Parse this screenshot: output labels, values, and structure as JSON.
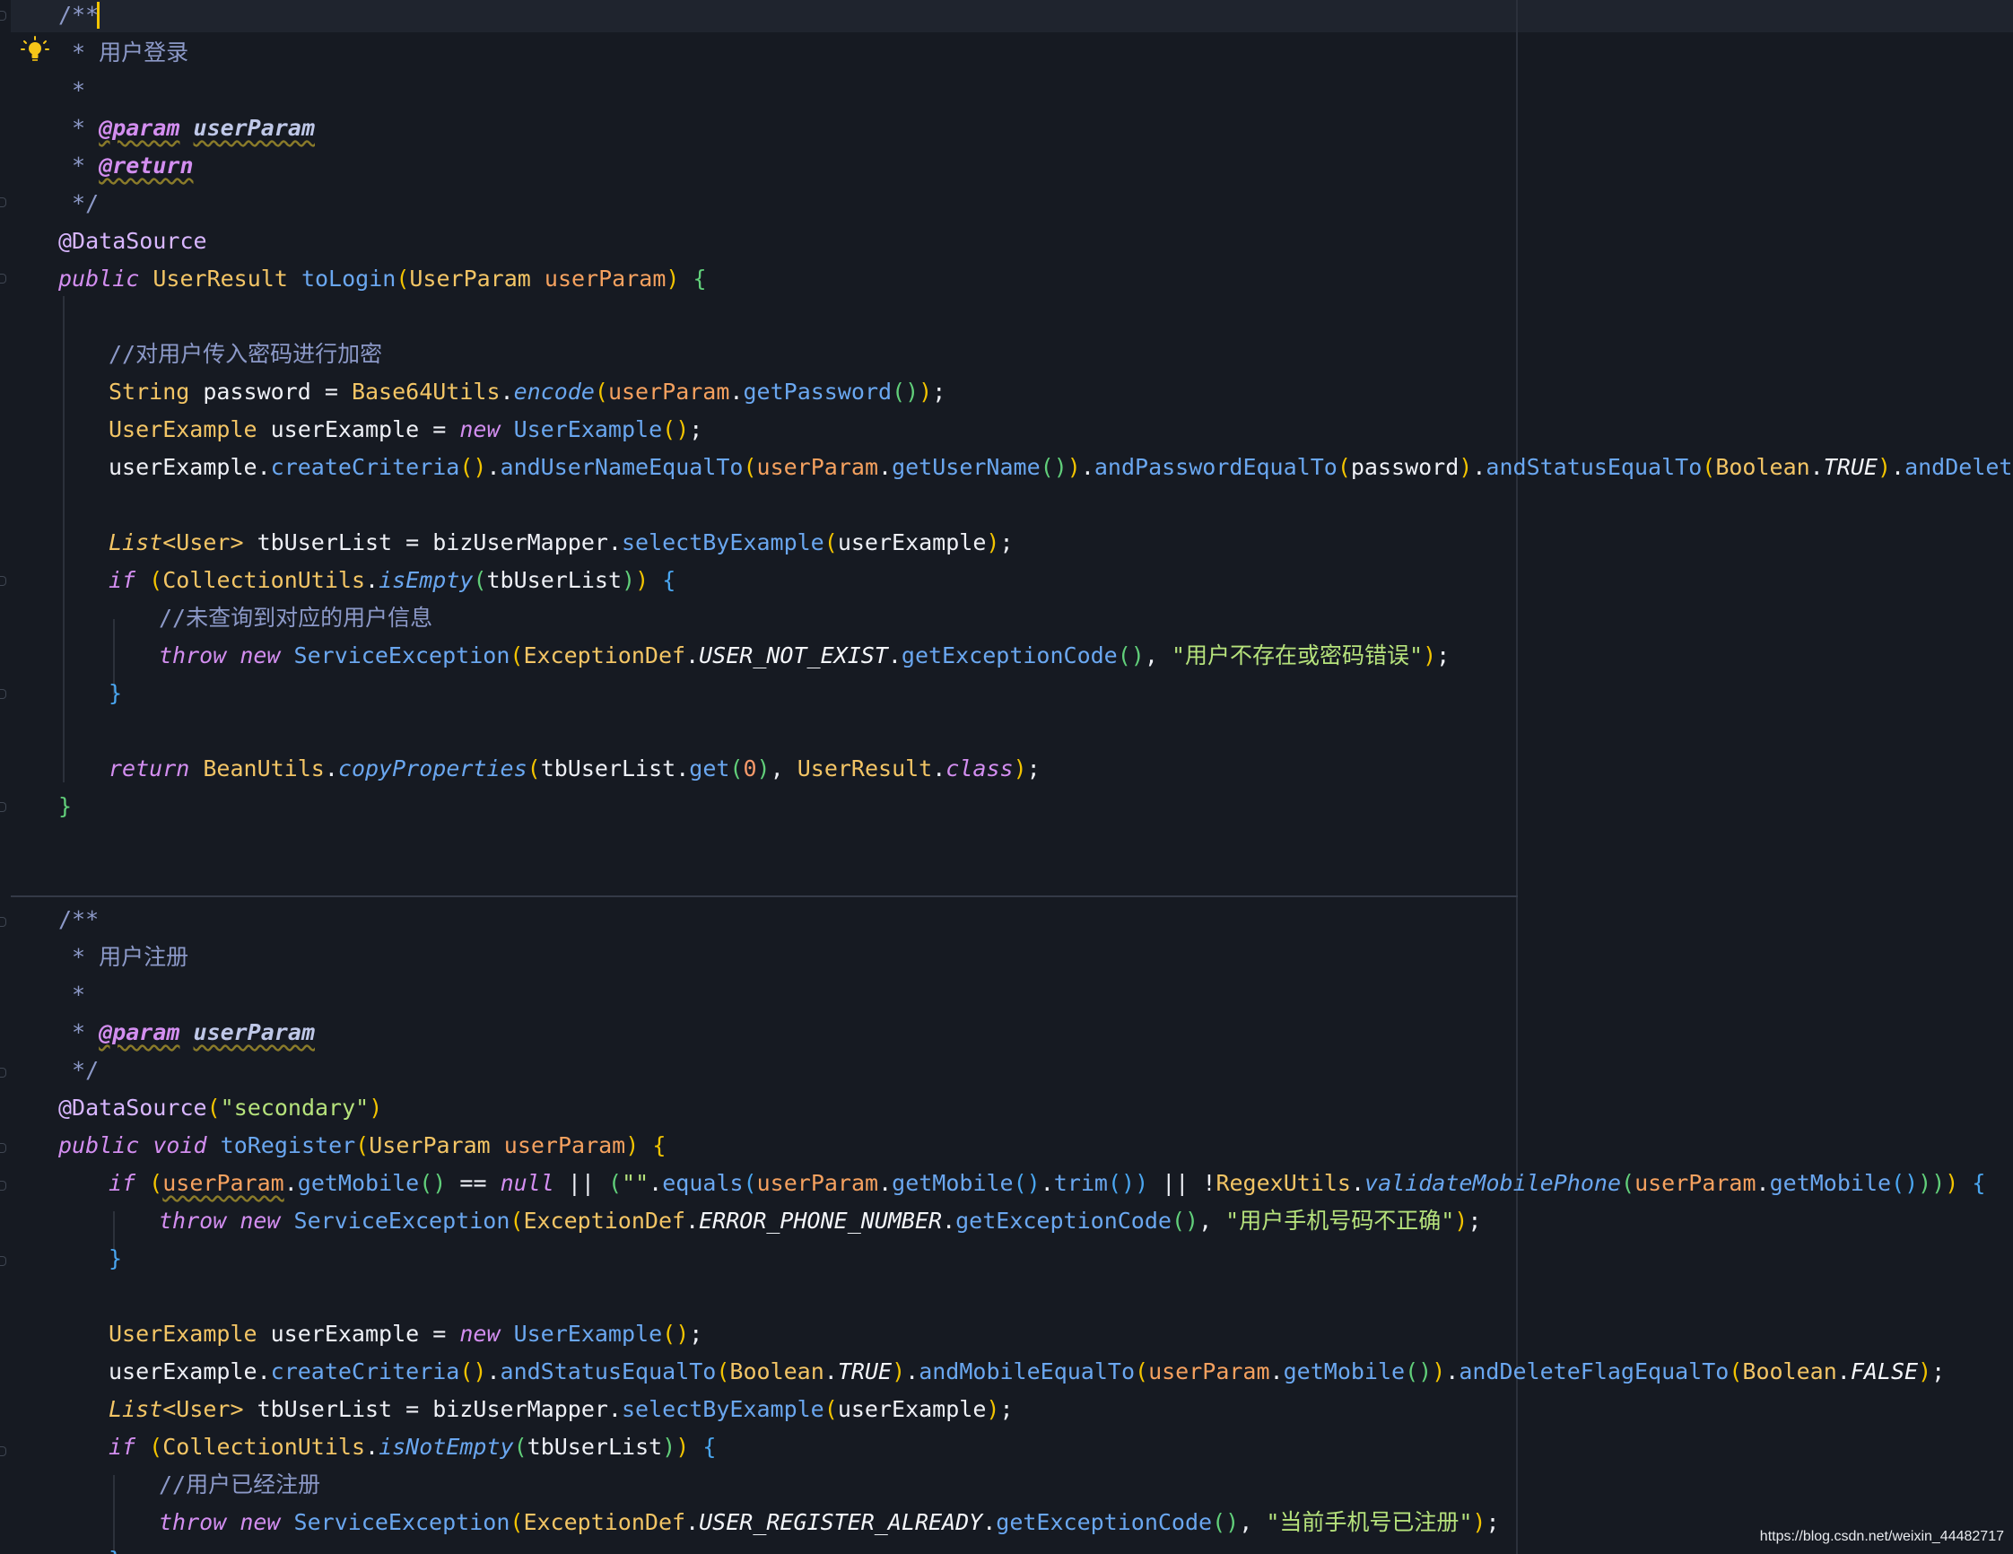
{
  "editor": {
    "language": "java",
    "theme_colors": {
      "background": "#161a22",
      "keyword": "#d38ef0",
      "class": "#f3c565",
      "method": "#6aa7f0",
      "comment": "#8c99c8",
      "string": "#b6e27c",
      "parameter": "#f5a15f",
      "caret": "#f3c400"
    },
    "gutter_icons": [
      "lightbulb-icon"
    ],
    "code": {
      "l1": "/**",
      "l2_star": " * ",
      "l2_text": "用户登录",
      "l3": " *",
      "l4_star": " * ",
      "l4_tag": "@param",
      "l4_sp": " ",
      "l4_name": "userParam",
      "l5_star": " * ",
      "l5_tag": "@return",
      "l6": " */",
      "l7": "@DataSource",
      "l8_kw": "public",
      "l8_sp1": " ",
      "l8_type": "UserResult",
      "l8_sp2": " ",
      "l8_fn": "toLogin",
      "l8_lp": "(",
      "l8_ptype": "UserParam",
      "l8_sp3": " ",
      "l8_pname": "userParam",
      "l8_rp": ")",
      "l8_sp4": " ",
      "l8_brace": "{",
      "l10": "//对用户传入密码进行加密",
      "l11_type": "String",
      "l11_var": " password = ",
      "l11_cls": "Base64Utils",
      "l11_dot": ".",
      "l11_fn": "encode",
      "l11_lp": "(",
      "l11_param": "userParam",
      "l11_dot2": ".",
      "l11_fn2": "getPassword",
      "l11_parens": "()",
      "l11_rp": ")",
      "l11_semi": ";",
      "l12_type": "UserExample",
      "l12_var": " userExample = ",
      "l12_kw": "new",
      "l12_sp": " ",
      "l12_fn": "UserExample",
      "l12_parens": "()",
      "l12_semi": ";",
      "l13_var": "userExample",
      "l13_d1": ".",
      "l13_f1": "createCriteria",
      "l13_p1": "()",
      "l13_d2": ".",
      "l13_f2": "andUserNameEqualTo",
      "l13_lp2": "(",
      "l13_param": "userParam",
      "l13_d3": ".",
      "l13_f3": "getUserName",
      "l13_p3": "()",
      "l13_rp2": ")",
      "l13_d4": ".",
      "l13_f4": "andPasswordEqualTo",
      "l13_lp4": "(",
      "l13_arg4": "password",
      "l13_rp4": ")",
      "l13_d5": ".",
      "l13_f5": "andStatusEqualTo",
      "l13_lp5": "(",
      "l13_cls5": "Boolean",
      "l13_d6": ".",
      "l13_const5": "TRUE",
      "l13_rp5": ")",
      "l13_d7": ".",
      "l13_f7": "andDeleteFlagEqualT",
      "l15_type": "List",
      "l15_gen": "<User>",
      "l15_var": " tbUserList = bizUserMapper.",
      "l15_fn": "selectByExample",
      "l15_lp": "(",
      "l15_arg": "userExample",
      "l15_rp": ")",
      "l15_semi": ";",
      "l16_kw": "if",
      "l16_sp": " ",
      "l16_lp": "(",
      "l16_cls": "CollectionUtils",
      "l16_dot": ".",
      "l16_fn": "isEmpty",
      "l16_lp2": "(",
      "l16_arg": "tbUserList",
      "l16_rp2": ")",
      "l16_rp": ")",
      "l16_sp2": " ",
      "l16_brace": "{",
      "l17": "//未查询到对应的用户信息",
      "l18_kw1": "throw",
      "l18_sp1": " ",
      "l18_kw2": "new",
      "l18_sp2": " ",
      "l18_fn": "ServiceException",
      "l18_lp": "(",
      "l18_cls": "ExceptionDef",
      "l18_dot": ".",
      "l18_const": "USER_NOT_EXIST",
      "l18_dot2": ".",
      "l18_fn2": "getExceptionCode",
      "l18_parens": "()",
      "l18_comma": ", ",
      "l18_str": "\"用户不存在或密码错误\"",
      "l18_rp": ")",
      "l18_semi": ";",
      "l19": "}",
      "l21_kw": "return",
      "l21_sp": " ",
      "l21_cls": "BeanUtils",
      "l21_dot": ".",
      "l21_fn": "copyProperties",
      "l21_lp": "(",
      "l21_arg": "tbUserList",
      "l21_dot2": ".",
      "l21_fn2": "get",
      "l21_lp2": "(",
      "l21_num": "0",
      "l21_rp2": ")",
      "l21_comma": ", ",
      "l21_cls2": "UserResult",
      "l21_dot3": ".",
      "l21_kw2": "class",
      "l21_rp": ")",
      "l21_semi": ";",
      "l22": "}",
      "r1": "/**",
      "r2_star": " * ",
      "r2_text": "用户注册",
      "r3": " *",
      "r4_star": " * ",
      "r4_tag": "@param",
      "r4_sp": " ",
      "r4_name": "userParam",
      "r5": " */",
      "r6_ann": "@DataSource",
      "r6_lp": "(",
      "r6_str": "\"secondary\"",
      "r6_rp": ")",
      "r7_kw": "public",
      "r7_sp1": " ",
      "r7_kw2": "void",
      "r7_sp2": " ",
      "r7_fn": "toRegister",
      "r7_lp": "(",
      "r7_ptype": "UserParam",
      "r7_sp3": " ",
      "r7_pname": "userParam",
      "r7_rp": ")",
      "r7_sp4": " ",
      "r7_brace": "{",
      "r8_kw": "if",
      "r8_sp": " ",
      "r8_lp": "(",
      "r8_param": "userParam",
      "r8_dot": ".",
      "r8_fn": "getMobile",
      "r8_parens": "()",
      "r8_eq": " == ",
      "r8_null": "null",
      "r8_or": " || ",
      "r8_lp2": "(",
      "r8_str": "\"\"",
      "r8_dot2": ".",
      "r8_fn2": "equals",
      "r8_lp3": "(",
      "r8_param2": "userParam",
      "r8_dot3": ".",
      "r8_fn3": "getMobile",
      "r8_parens2": "()",
      "r8_dot4": ".",
      "r8_fn4": "trim",
      "r8_parens3": "()",
      "r8_rp3": ")",
      "r8_or2": " || !",
      "r8_cls": "RegexUtils",
      "r8_dot5": ".",
      "r8_fn5": "validateMobilePhone",
      "r8_lp4": "(",
      "r8_param3": "userParam",
      "r8_dot6": ".",
      "r8_fn6": "getMobile",
      "r8_parens4": "()",
      "r8_rp4": ")",
      "r8_rp5": ")",
      "r8_rp": ")",
      "r8_sp2": " ",
      "r8_brace": "{",
      "r9_kw1": "throw",
      "r9_sp1": " ",
      "r9_kw2": "new",
      "r9_sp2": " ",
      "r9_fn": "ServiceException",
      "r9_lp": "(",
      "r9_cls": "ExceptionDef",
      "r9_dot": ".",
      "r9_const": "ERROR_PHONE_NUMBER",
      "r9_dot2": ".",
      "r9_fn2": "getExceptionCode",
      "r9_parens": "()",
      "r9_comma": ", ",
      "r9_str": "\"用户手机号码不正确\"",
      "r9_rp": ")",
      "r9_semi": ";",
      "r10": "}",
      "r12_type": "UserExample",
      "r12_var": " userExample = ",
      "r12_kw": "new",
      "r12_sp": " ",
      "r12_fn": "UserExample",
      "r12_parens": "()",
      "r12_semi": ";",
      "r13_var": "userExample",
      "r13_d1": ".",
      "r13_f1": "createCriteria",
      "r13_p1": "()",
      "r13_d2": ".",
      "r13_f2": "andStatusEqualTo",
      "r13_lp2": "(",
      "r13_cls2": "Boolean",
      "r13_d3": ".",
      "r13_const2": "TRUE",
      "r13_rp2": ")",
      "r13_d4": ".",
      "r13_f4": "andMobileEqualTo",
      "r13_lp4": "(",
      "r13_param4": "userParam",
      "r13_d5": ".",
      "r13_f5": "getMobile",
      "r13_p5": "()",
      "r13_rp4": ")",
      "r13_d6": ".",
      "r13_f6": "andDeleteFlagEqualTo",
      "r13_lp6": "(",
      "r13_cls6": "Boolean",
      "r13_d7": ".",
      "r13_const6": "FALSE",
      "r13_rp6": ")",
      "r13_semi": ";",
      "r14_type": "List",
      "r14_gen": "<User>",
      "r14_var": " tbUserList = bizUserMapper.",
      "r14_fn": "selectByExample",
      "r14_lp": "(",
      "r14_arg": "userExample",
      "r14_rp": ")",
      "r14_semi": ";",
      "r15_kw": "if",
      "r15_sp": " ",
      "r15_lp": "(",
      "r15_cls": "CollectionUtils",
      "r15_dot": ".",
      "r15_fn": "isNotEmpty",
      "r15_lp2": "(",
      "r15_arg": "tbUserList",
      "r15_rp2": ")",
      "r15_rp": ")",
      "r15_sp2": " ",
      "r15_brace": "{",
      "r16": "//用户已经注册",
      "r17_kw1": "throw",
      "r17_sp1": " ",
      "r17_kw2": "new",
      "r17_sp2": " ",
      "r17_fn": "ServiceException",
      "r17_lp": "(",
      "r17_cls": "ExceptionDef",
      "r17_dot": ".",
      "r17_const": "USER_REGISTER_ALREADY",
      "r17_dot2": ".",
      "r17_fn2": "getExceptionCode",
      "r17_parens": "()",
      "r17_comma": ", ",
      "r17_str": "\"当前手机号已注册\"",
      "r17_rp": ")",
      "r17_semi": ";",
      "r18": "}"
    }
  },
  "watermark": "https://blog.csdn.net/weixin_44482717"
}
